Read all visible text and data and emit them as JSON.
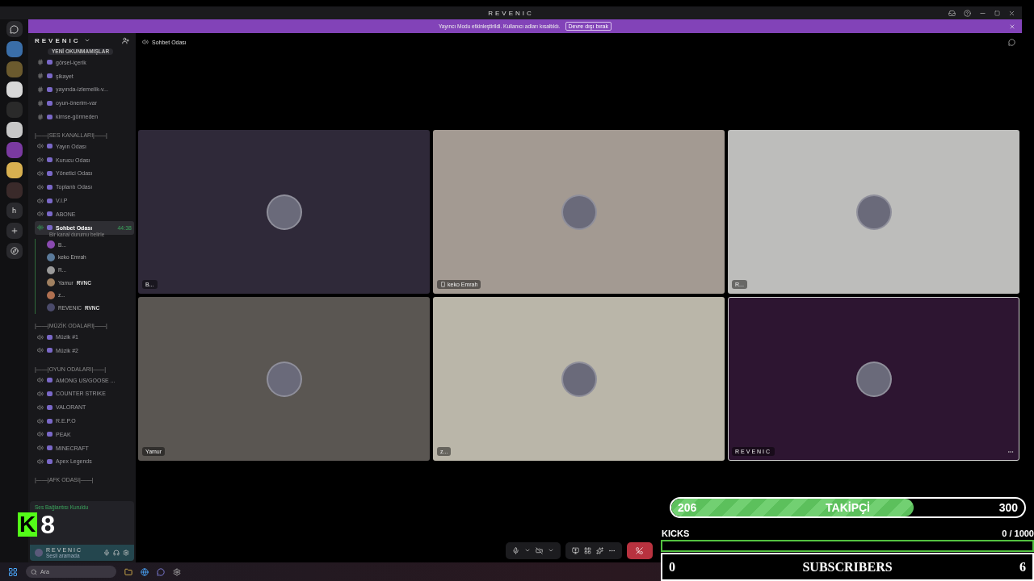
{
  "window": {
    "title": "REVENIC"
  },
  "banner": {
    "text": "Yayıncı Modu etkinleştirildi. Kullanıcı adları kısaltıldı.",
    "button": "Devre dışı bırak"
  },
  "servers": [
    {
      "color": "#3a6ea8"
    },
    {
      "color": "#6b5a2e"
    },
    {
      "color": "#d8d8d8"
    },
    {
      "color": "#2a2a2a"
    },
    {
      "color": "#c8c8c8"
    },
    {
      "color": "#7a3aa0"
    },
    {
      "color": "#d8b050"
    },
    {
      "color": "#3a2a2a"
    }
  ],
  "server_letter": "h",
  "server": {
    "name": "REVENIC"
  },
  "unread_pill": "YENİ OKUNMAMIŞLAR",
  "text_channels": [
    {
      "name": "görsel-içerik"
    },
    {
      "name": "şikayet"
    },
    {
      "name": "yayında-izlemelik-v..."
    },
    {
      "name": "oyun-önerim-var"
    },
    {
      "name": "kimse-görmeden"
    }
  ],
  "sections": [
    {
      "header": "|——|SES KANALLARI|——|",
      "channels": [
        {
          "name": "Yayın Odası",
          "selected": false
        },
        {
          "name": "Kurucu Odası",
          "selected": false
        },
        {
          "name": "Yönetici Odası",
          "selected": false
        },
        {
          "name": "Toplantı Odası",
          "selected": false
        },
        {
          "name": "V.I.P",
          "selected": false
        },
        {
          "name": "ABONE",
          "selected": false
        },
        {
          "name": "Sohbet Odası",
          "selected": true,
          "timer": "44:38",
          "status": "Bir kanal durumu belirle",
          "members": [
            {
              "name": "B...",
              "color": "#8a4ab0"
            },
            {
              "name": "keko Emrah",
              "color": "#5a7a9a"
            },
            {
              "name": "R...",
              "color": "#9a9a9a"
            },
            {
              "name": "Yamur",
              "color": "#a08060",
              "badge": "RVNC"
            },
            {
              "name": "z...",
              "color": "#b07050"
            },
            {
              "name": "REVENIC",
              "color": "#4a4a6a",
              "badge": "RVNC"
            }
          ]
        }
      ]
    },
    {
      "header": "|——|MÜZİK ODALARI|——|",
      "channels": [
        {
          "name": "Müzik #1",
          "selected": false
        },
        {
          "name": "Müzik #2",
          "selected": false
        }
      ]
    },
    {
      "header": "|——|OYUN ODALARI|——|",
      "channels": [
        {
          "name": "AMONG US/GOOSE ...",
          "selected": false
        },
        {
          "name": "COUNTER STRIKE",
          "selected": false
        },
        {
          "name": "VALORANT",
          "selected": false
        },
        {
          "name": "R.E.P.O",
          "selected": false
        },
        {
          "name": "PEAK",
          "selected": false
        },
        {
          "name": "MINECRAFT",
          "selected": false
        },
        {
          "name": "Apex Legends",
          "selected": false
        }
      ]
    },
    {
      "header": "|——|AFK ODASI|——|"
    }
  ],
  "voice_panel": {
    "status": "Ses Bağlantısı Kuruldu",
    "user": "REVENIC",
    "user_status": "Sesli aramada"
  },
  "overlay_badge": {
    "letter": "K",
    "count": "8"
  },
  "channel_header": {
    "title": "Sohbet Odası"
  },
  "tiles": [
    {
      "label": "B...",
      "color": "#2f2939",
      "selected": false,
      "mobile": false
    },
    {
      "label": "keko Emrah",
      "color": "#a39a92",
      "selected": false,
      "mobile": true
    },
    {
      "label": "R...",
      "color": "#bdbdbb",
      "selected": false,
      "mobile": false
    },
    {
      "label": "Yamur",
      "color": "#5a5652",
      "selected": false,
      "mobile": false
    },
    {
      "label": "z...",
      "color": "#bab6a9",
      "selected": false,
      "mobile": false
    },
    {
      "label": "REVENIC",
      "color": "#2d1531",
      "selected": true,
      "mobile": false
    }
  ],
  "stream": {
    "followers": {
      "current": "206",
      "label": "TAKİPÇİ",
      "goal": "300",
      "level": 0.687
    },
    "kicks": {
      "label": "KICKS",
      "current": "0",
      "goal": "/ 1000",
      "level": 0
    },
    "subscribers": {
      "current": "0",
      "label": "SUBSCRIBERS",
      "goal": "6"
    }
  },
  "taskbar": {
    "search_placeholder": "Ara"
  }
}
